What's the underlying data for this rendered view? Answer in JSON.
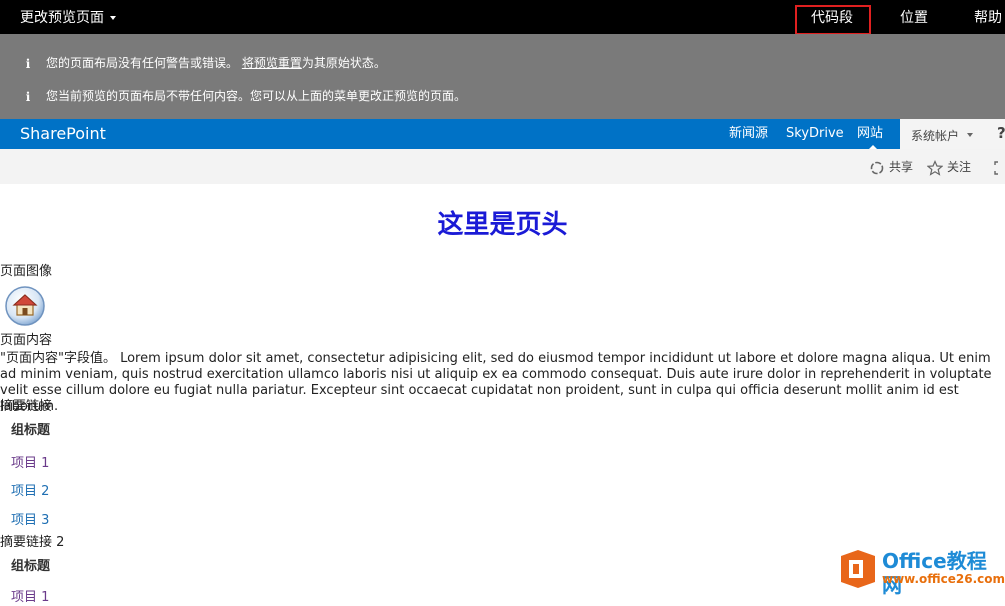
{
  "topbar": {
    "change_preview": "更改预览页面",
    "menu": [
      "代码段",
      "位置",
      "帮助"
    ]
  },
  "status": {
    "row1_prefix": "您的页面布局没有任何警告或错误。",
    "row1_link": "将预览重置",
    "row1_suffix": "为其原始状态。",
    "row2": "您当前预览的页面布局不带任何内容。您可以从上面的菜单更改正预览的页面。"
  },
  "suite": {
    "brand": "SharePoint",
    "links": [
      "新闻源",
      "SkyDrive",
      "网站"
    ],
    "account": "系统帐户",
    "help": "?"
  },
  "ribbon": {
    "share": "共享",
    "follow": "关注"
  },
  "page": {
    "header_title": "这里是页头",
    "image_label": "页面图像",
    "content_label": "页面内容",
    "content_text": "\"页面内容\"字段值。 Lorem ipsum dolor sit amet, consectetur adipisicing elit, sed do eiusmod tempor incididunt ut labore et dolore magna aliqua. Ut enim ad minim veniam, quis nostrud exercitation ullamco laboris nisi ut aliquip ex ea commodo consequat. Duis aute irure dolor in reprehenderit in voluptate velit esse cillum dolore eu fugiat nulla pariatur. Excepteur sint occaecat cupidatat non proident, sunt in culpa qui officia deserunt mollit anim id est laborum.",
    "summary1": {
      "label": "摘要链接",
      "group_title": "组标题",
      "items": [
        "项目 1",
        "项目 2",
        "项目 3"
      ]
    },
    "summary2": {
      "label": "摘要链接 2",
      "group_title": "组标题",
      "items": [
        "项目 1"
      ]
    }
  },
  "watermark": {
    "title": "Office教程网",
    "url": "www.office26.com"
  },
  "colors": {
    "topbar": "#000000",
    "status": "#7a7a7a",
    "suite": "#0072c6",
    "header_title": "#1a1ad6",
    "highlight": "#e02020"
  }
}
